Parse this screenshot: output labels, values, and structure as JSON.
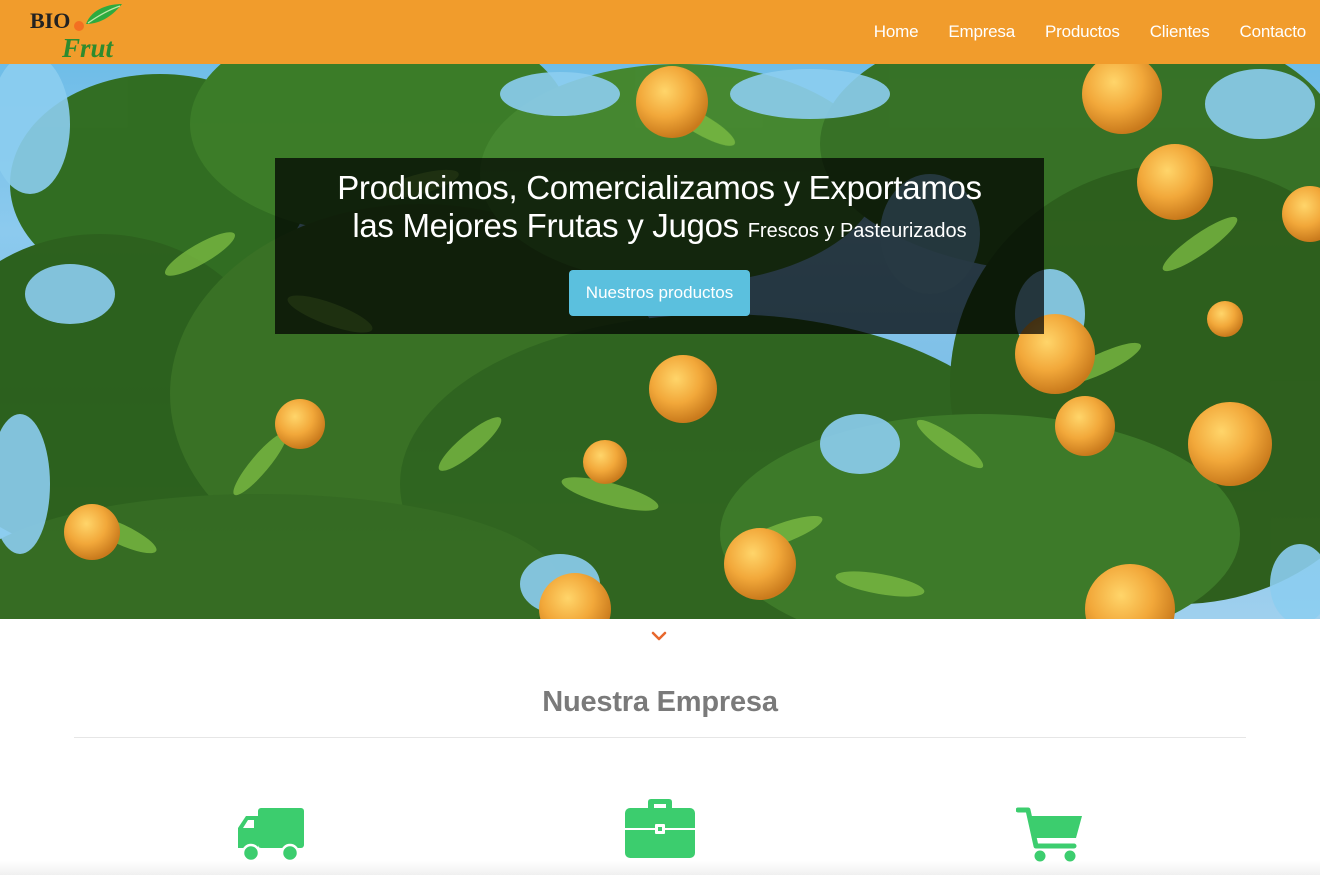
{
  "brand": {
    "logo_top": "BIO",
    "logo_bottom": "Frut",
    "accent": "#f19c2c",
    "green": "#2eab3f"
  },
  "nav": {
    "items": [
      {
        "label": "Home"
      },
      {
        "label": "Empresa"
      },
      {
        "label": "Productos"
      },
      {
        "label": "Clientes"
      },
      {
        "label": "Contacto"
      }
    ]
  },
  "hero": {
    "title_line1": "Producimos, Comercializamos y Exportamos",
    "title_line2": "las Mejores Frutas y Jugos",
    "title_small": "Frescos y Pasteurizados",
    "cta_label": "Nuestros productos",
    "cta_color": "#5bc0de"
  },
  "scroll_indicator": {
    "icon": "chevron-down-icon",
    "color": "#e8672c"
  },
  "empresa": {
    "title": "Nuestra Empresa",
    "features": [
      {
        "icon": "truck-icon"
      },
      {
        "icon": "briefcase-icon"
      },
      {
        "icon": "shopping-cart-icon"
      }
    ],
    "icon_color": "#3ccd6e"
  }
}
